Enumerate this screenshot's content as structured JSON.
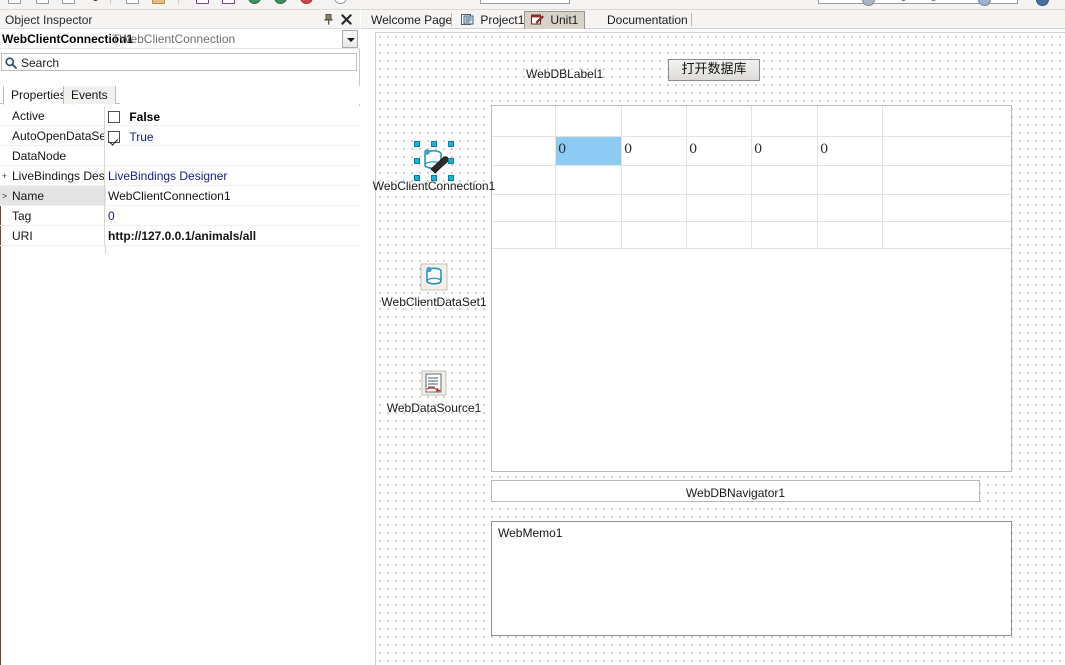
{
  "window": {
    "title": "Delphi IDE Form Designer"
  },
  "toolbar": {
    "icons": [
      "new-file-icon",
      "open-file-icon",
      "save-file-icon",
      "save-all-icon",
      "run-icon",
      "pause-icon",
      "print-icon",
      "folder-icon",
      "form-view-icon",
      "unit-view-icon",
      "step-over-icon",
      "step-into-icon",
      "stop-icon",
      "search-icon",
      "help-icon"
    ],
    "combo_value": ""
  },
  "object_inspector": {
    "title": "Object Inspector",
    "pin_icon": "pin-icon",
    "close_icon": "close-icon",
    "selected_object": "WebClientConnection1",
    "selected_class": "TWebClientConnection",
    "dropdown_icon": "chevron-down-icon",
    "search": {
      "icon": "search-icon",
      "value": "Search",
      "placeholder": "Search"
    },
    "tabs": [
      {
        "label": "Properties",
        "active": true
      },
      {
        "label": "Events",
        "active": false
      }
    ],
    "properties": [
      {
        "gutter": "",
        "name": "Active",
        "value": "False",
        "kind": "checkbox",
        "checked": false,
        "bold": true,
        "selected": false
      },
      {
        "gutter": "",
        "name": "AutoOpenDataSet",
        "value": "True",
        "kind": "checkbox",
        "checked": true,
        "bold": false,
        "blue": true,
        "selected": false
      },
      {
        "gutter": "",
        "name": "DataNode",
        "value": "",
        "kind": "text",
        "selected": false
      },
      {
        "gutter": "+",
        "name": "LiveBindings Desig",
        "value": "LiveBindings Designer",
        "kind": "link",
        "selected": false
      },
      {
        "gutter": ">",
        "name": "Name",
        "value": "WebClientConnection1",
        "kind": "text",
        "selected": true
      },
      {
        "gutter": "",
        "name": "Tag",
        "value": "0",
        "kind": "text",
        "blue": true,
        "selected": false
      },
      {
        "gutter": "",
        "name": "URI",
        "value": "http://127.0.0.1/animals/all",
        "kind": "text",
        "bold": true,
        "selected": false
      }
    ]
  },
  "editor_tabs": [
    {
      "label": "Welcome Page",
      "icon": "",
      "active": false
    },
    {
      "label": "Project1",
      "icon": "project-icon",
      "active": false
    },
    {
      "label": "Unit1",
      "icon": "unit-form-icon",
      "active": true
    },
    {
      "label": "Documentation",
      "icon": "",
      "active": false
    }
  ],
  "designer": {
    "label_webdblabel": "WebDBLabel1",
    "button_open_db": "打开数据库",
    "navigator_caption": "WebDBNavigator1",
    "memo_text": "WebMemo1",
    "components": [
      {
        "name": "WebClientConnection1",
        "icon": "web-client-connection-icon",
        "selected": true
      },
      {
        "name": "WebClientDataSet1",
        "icon": "web-client-dataset-icon",
        "selected": false
      },
      {
        "name": "WebDataSource1",
        "icon": "web-datasource-icon",
        "selected": false
      }
    ],
    "dbgrid": {
      "row_values": [
        "0",
        "0",
        "0",
        "0",
        "0"
      ],
      "selected_cell_index": 0,
      "columns": 6,
      "rows": 5
    }
  },
  "colors": {
    "selection_blue": "#8dcbf5",
    "panel_bg": "#f5f4f2",
    "accent_teal": "#14b5d8",
    "row_select_gray": "#e4e4e4"
  }
}
